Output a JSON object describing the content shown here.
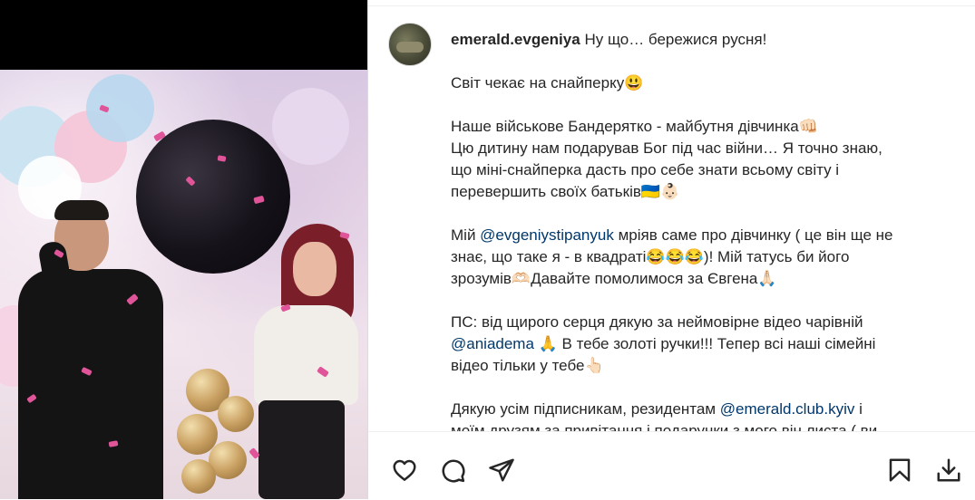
{
  "post": {
    "username": "emerald.evgeniya",
    "lines": {
      "l1": "Ну що… бережися русня!",
      "l2": "Світ чекає на снайперку😃",
      "l3": "Наше військове Бандерятко - майбутня дівчинка👊🏻",
      "l4": "Цю дитину нам подарував Бог під час війни… Я точно знаю,",
      "l5": "що міні-снайперка дасть про себе знати всьому світу і",
      "l6": "перевершить своїх батьків🇺🇦👶🏻",
      "l7_a": "Мій ",
      "l7_mention": "@evgeniystipanyuk",
      "l7_b": " мріяв саме про дівчинку ( це він ще не",
      "l8": "знає, що таке я - в квадраті😂😂😂)! Мій татусь би його",
      "l9": "зрозумів🫶🏻Давайте помолимося за Євгена🙏🏻",
      "l10": "ПС: від щирого серця дякую за неймовірне відео чарівній",
      "l11_mention": "@aniadema",
      "l11_b": " 🙏 В тебе золоті ручки!!! Тепер всі наші сімейні",
      "l12": "відео тільки у тебе👆🏻",
      "l13_a": "Дякую усім підписникам, резидентам ",
      "l13_mention": "@emerald.club.kyiv",
      "l13_b": " і",
      "l14": "моїм друзям за привітання і подарунки з мого він листа ( ви"
    }
  },
  "actions": {
    "like": "heart-icon",
    "comment": "comment-icon",
    "share": "send-icon",
    "save": "bookmark-icon",
    "download": "download-icon"
  },
  "colors": {
    "text": "#262626",
    "mention": "#00376b",
    "border": "#dbdbdb"
  }
}
